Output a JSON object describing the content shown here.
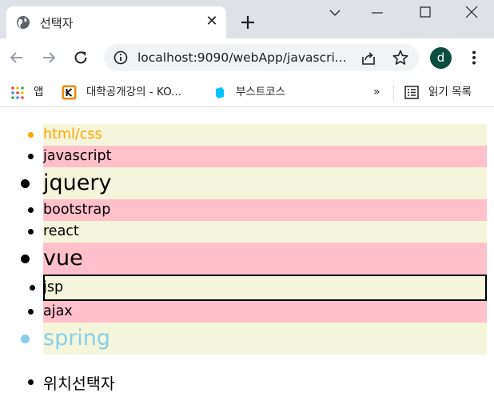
{
  "tab": {
    "title": "선택자",
    "close_glyph": "✕",
    "favicon": "globe-icon"
  },
  "toolbar": {
    "url": "localhost:9090/webApp/javascri...",
    "profile_initial": "d"
  },
  "bookmarks": {
    "items": [
      {
        "label": "앱",
        "icon": "apps-grid-icon"
      },
      {
        "label": "대학공개강의 - KO...",
        "icon": "kocw-icon"
      },
      {
        "label": "부스트코스",
        "icon": "boostcourse-icon"
      }
    ],
    "more_glyph": "»",
    "reading_list": "읽기 목록"
  },
  "page": {
    "list": [
      {
        "text": "html/css",
        "color": "#ffa500",
        "bg": "#f5f5dc",
        "size": "medium",
        "boxed": false
      },
      {
        "text": "javascript",
        "color": "#000000",
        "bg": "#ffc0cb",
        "size": "medium",
        "boxed": false
      },
      {
        "text": "jquery",
        "color": "#000000",
        "bg": "#f5f5dc",
        "size": "large",
        "boxed": false
      },
      {
        "text": "bootstrap",
        "color": "#000000",
        "bg": "#ffc0cb",
        "size": "medium",
        "boxed": false
      },
      {
        "text": "react",
        "color": "#000000",
        "bg": "#f5f5dc",
        "size": "medium",
        "boxed": false
      },
      {
        "text": "vue",
        "color": "#000000",
        "bg": "#ffc0cb",
        "size": "large",
        "boxed": false
      },
      {
        "text": "jsp",
        "color": "#000000",
        "bg": "#f5f5dc",
        "size": "medium",
        "boxed": true
      },
      {
        "text": "ajax",
        "color": "#000000",
        "bg": "#ffc0cb",
        "size": "medium",
        "boxed": false
      },
      {
        "text": "spring",
        "color": "#87ceeb",
        "bg": "#f5f5dc",
        "size": "large",
        "boxed": false
      }
    ],
    "heading_item": "위치선택자"
  }
}
